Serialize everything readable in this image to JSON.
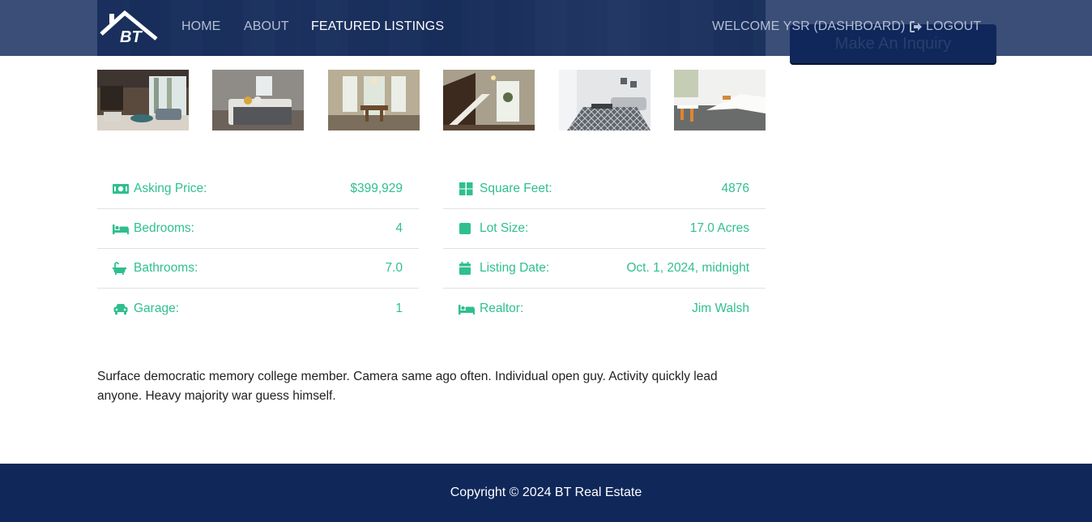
{
  "brand": {
    "logo_text": "BT"
  },
  "nav": {
    "home": "HOME",
    "about": "ABOUT",
    "featured": "FEATURED LISTINGS",
    "welcome": "WELCOME YSR (DASHBOARD)",
    "logout": "LOGOUT"
  },
  "inquiry_button": "Make An Inquiry",
  "gallery": [
    "living-room",
    "bedroom",
    "dining-room",
    "staircase",
    "lounge",
    "kitchen"
  ],
  "stats_left": [
    {
      "icon": "money-icon",
      "label": "Asking Price:",
      "value": "$399,929"
    },
    {
      "icon": "bed-icon",
      "label": "Bedrooms:",
      "value": "4"
    },
    {
      "icon": "bath-icon",
      "label": "Bathrooms:",
      "value": "7.0"
    },
    {
      "icon": "car-icon",
      "label": "Garage:",
      "value": "1"
    }
  ],
  "stats_right": [
    {
      "icon": "grid-icon",
      "label": "Square Feet:",
      "value": "4876"
    },
    {
      "icon": "square-icon",
      "label": "Lot Size:",
      "value": "17.0 Acres"
    },
    {
      "icon": "calendar-icon",
      "label": "Listing Date:",
      "value": "Oct. 1, 2024, midnight"
    },
    {
      "icon": "bed-icon",
      "label": "Realtor:",
      "value": "Jim Walsh"
    }
  ],
  "description": "Surface democratic memory college member. Camera same ago often. Individual open guy. Activity quickly lead anyone. Heavy majority war guess himself.",
  "footer": {
    "copyright": "Copyright © 2024 BT Real Estate"
  },
  "colors": {
    "navy": "#10275a",
    "accent": "#2fbf8f"
  }
}
